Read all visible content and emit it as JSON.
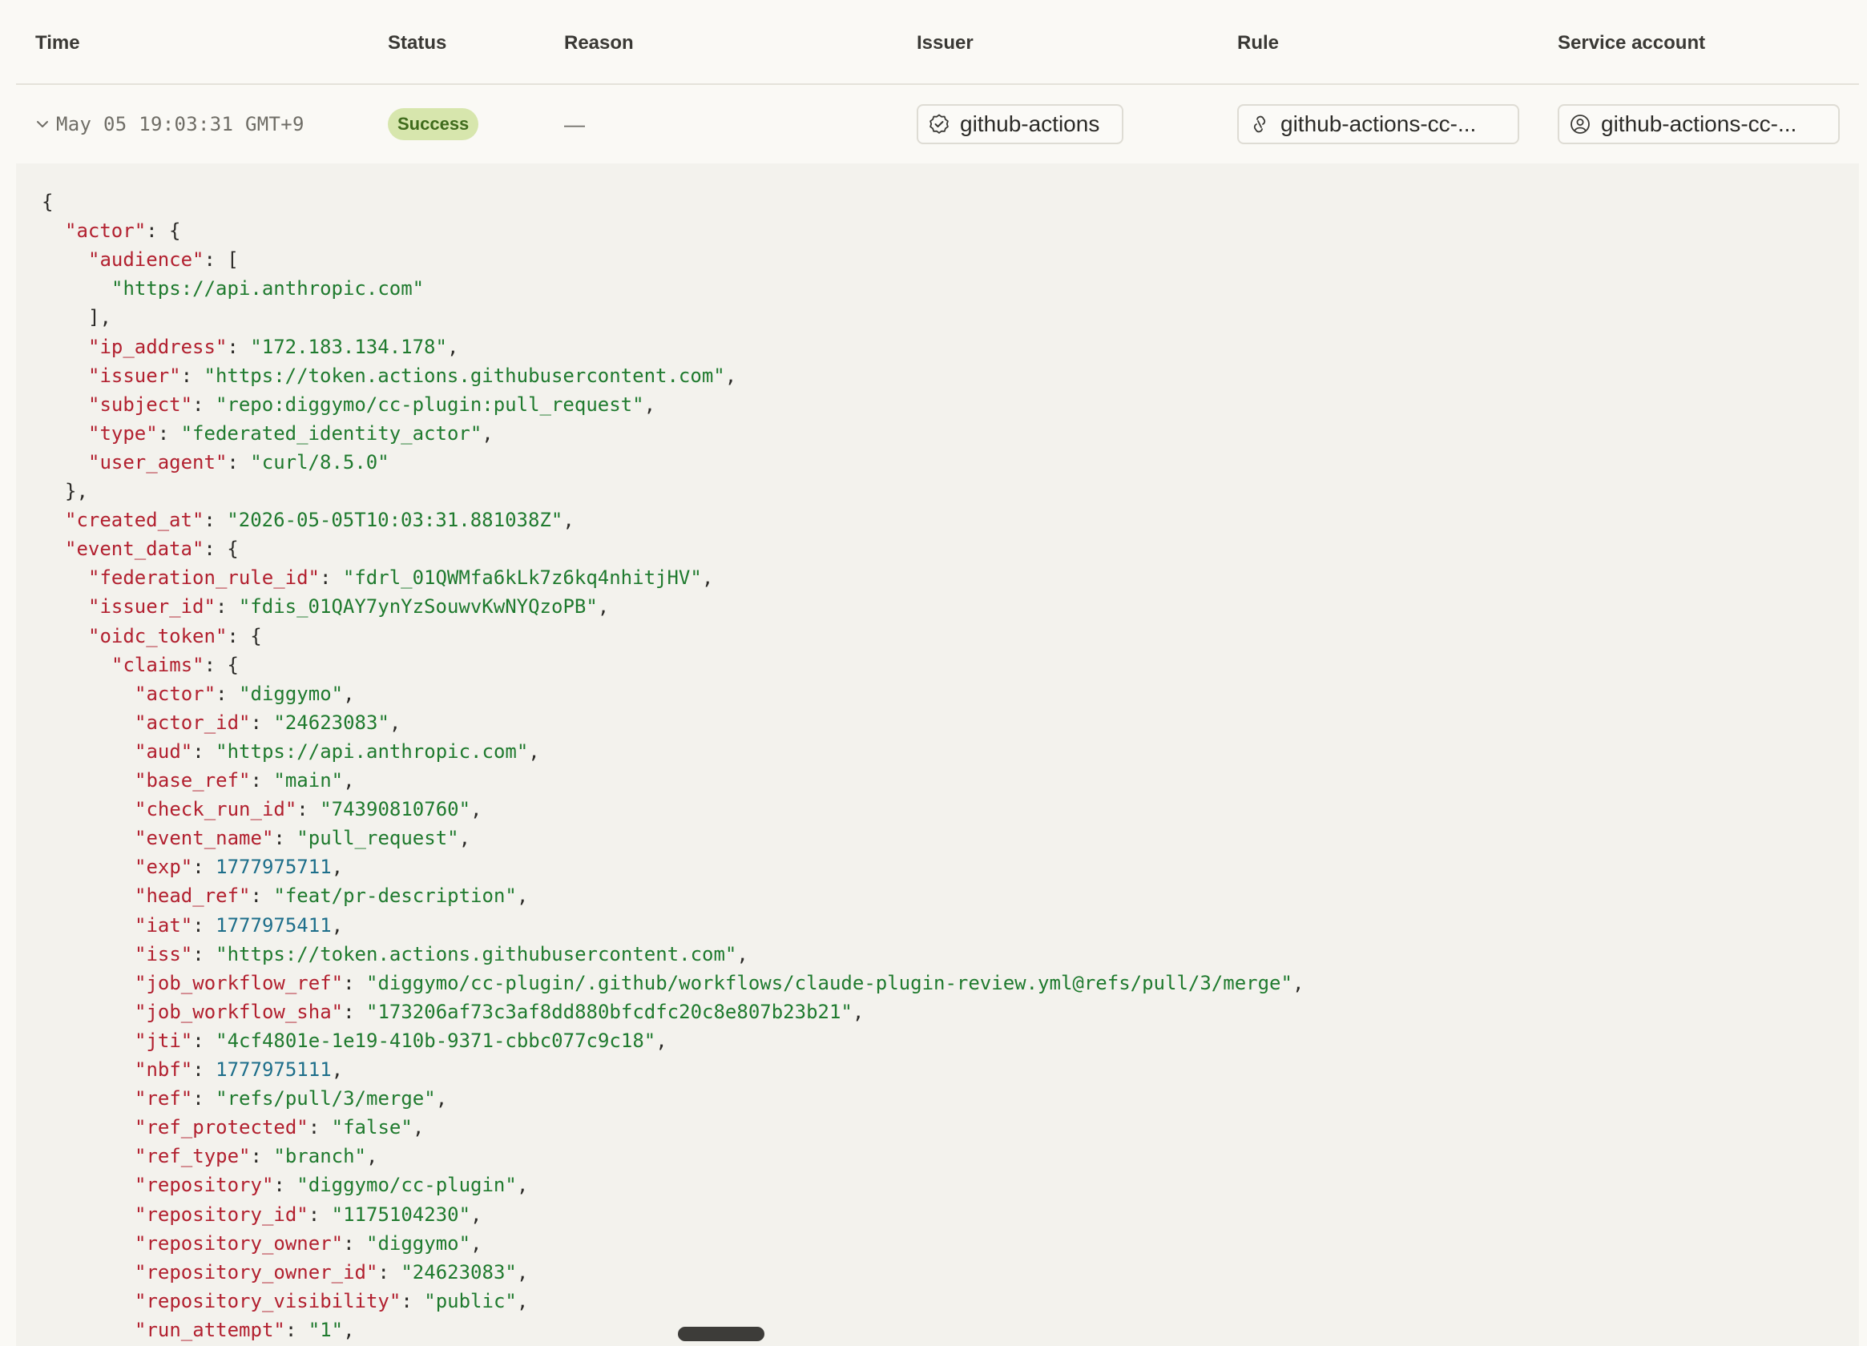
{
  "columns": {
    "time": "Time",
    "status": "Status",
    "reason": "Reason",
    "issuer": "Issuer",
    "rule": "Rule",
    "service_account": "Service account"
  },
  "row": {
    "time": "May 05 19:03:31 GMT+9",
    "status": "Success",
    "reason": "—",
    "issuer": "github-actions",
    "rule": "github-actions-cc-...",
    "service_account": "github-actions-cc-..."
  },
  "colors": {
    "key": "#b2202f",
    "string": "#1f7a2e",
    "number": "#1d6e8a",
    "badge_bg": "#d7e6ad",
    "badge_text": "#3f6b1c"
  },
  "icons": {
    "expand": "chevron-down-icon",
    "issuer": "verified-badge-icon",
    "rule": "link-icon",
    "service_account": "user-circle-icon"
  },
  "json_lines": [
    {
      "indent": 0,
      "parts": [
        {
          "t": "p",
          "v": "{"
        }
      ]
    },
    {
      "indent": 1,
      "parts": [
        {
          "t": "k",
          "v": "\"actor\""
        },
        {
          "t": "p",
          "v": ": {"
        }
      ]
    },
    {
      "indent": 2,
      "parts": [
        {
          "t": "k",
          "v": "\"audience\""
        },
        {
          "t": "p",
          "v": ": ["
        }
      ]
    },
    {
      "indent": 3,
      "parts": [
        {
          "t": "s",
          "v": "\"https://api.anthropic.com\""
        }
      ]
    },
    {
      "indent": 2,
      "parts": [
        {
          "t": "p",
          "v": "],"
        }
      ]
    },
    {
      "indent": 2,
      "parts": [
        {
          "t": "k",
          "v": "\"ip_address\""
        },
        {
          "t": "p",
          "v": ": "
        },
        {
          "t": "s",
          "v": "\"172.183.134.178\""
        },
        {
          "t": "p",
          "v": ","
        }
      ]
    },
    {
      "indent": 2,
      "parts": [
        {
          "t": "k",
          "v": "\"issuer\""
        },
        {
          "t": "p",
          "v": ": "
        },
        {
          "t": "s",
          "v": "\"https://token.actions.githubusercontent.com\""
        },
        {
          "t": "p",
          "v": ","
        }
      ]
    },
    {
      "indent": 2,
      "parts": [
        {
          "t": "k",
          "v": "\"subject\""
        },
        {
          "t": "p",
          "v": ": "
        },
        {
          "t": "s",
          "v": "\"repo:diggymo/cc-plugin:pull_request\""
        },
        {
          "t": "p",
          "v": ","
        }
      ]
    },
    {
      "indent": 2,
      "parts": [
        {
          "t": "k",
          "v": "\"type\""
        },
        {
          "t": "p",
          "v": ": "
        },
        {
          "t": "s",
          "v": "\"federated_identity_actor\""
        },
        {
          "t": "p",
          "v": ","
        }
      ]
    },
    {
      "indent": 2,
      "parts": [
        {
          "t": "k",
          "v": "\"user_agent\""
        },
        {
          "t": "p",
          "v": ": "
        },
        {
          "t": "s",
          "v": "\"curl/8.5.0\""
        }
      ]
    },
    {
      "indent": 1,
      "parts": [
        {
          "t": "p",
          "v": "},"
        }
      ]
    },
    {
      "indent": 1,
      "parts": [
        {
          "t": "k",
          "v": "\"created_at\""
        },
        {
          "t": "p",
          "v": ": "
        },
        {
          "t": "s",
          "v": "\"2026-05-05T10:03:31.881038Z\""
        },
        {
          "t": "p",
          "v": ","
        }
      ]
    },
    {
      "indent": 1,
      "parts": [
        {
          "t": "k",
          "v": "\"event_data\""
        },
        {
          "t": "p",
          "v": ": {"
        }
      ]
    },
    {
      "indent": 2,
      "parts": [
        {
          "t": "k",
          "v": "\"federation_rule_id\""
        },
        {
          "t": "p",
          "v": ": "
        },
        {
          "t": "s",
          "v": "\"fdrl_01QWMfa6kLk7z6kq4nhitjHV\""
        },
        {
          "t": "p",
          "v": ","
        }
      ]
    },
    {
      "indent": 2,
      "parts": [
        {
          "t": "k",
          "v": "\"issuer_id\""
        },
        {
          "t": "p",
          "v": ": "
        },
        {
          "t": "s",
          "v": "\"fdis_01QAY7ynYzSouwvKwNYQzoPB\""
        },
        {
          "t": "p",
          "v": ","
        }
      ]
    },
    {
      "indent": 2,
      "parts": [
        {
          "t": "k",
          "v": "\"oidc_token\""
        },
        {
          "t": "p",
          "v": ": {"
        }
      ]
    },
    {
      "indent": 3,
      "parts": [
        {
          "t": "k",
          "v": "\"claims\""
        },
        {
          "t": "p",
          "v": ": {"
        }
      ]
    },
    {
      "indent": 4,
      "parts": [
        {
          "t": "k",
          "v": "\"actor\""
        },
        {
          "t": "p",
          "v": ": "
        },
        {
          "t": "s",
          "v": "\"diggymo\""
        },
        {
          "t": "p",
          "v": ","
        }
      ]
    },
    {
      "indent": 4,
      "parts": [
        {
          "t": "k",
          "v": "\"actor_id\""
        },
        {
          "t": "p",
          "v": ": "
        },
        {
          "t": "s",
          "v": "\"24623083\""
        },
        {
          "t": "p",
          "v": ","
        }
      ]
    },
    {
      "indent": 4,
      "parts": [
        {
          "t": "k",
          "v": "\"aud\""
        },
        {
          "t": "p",
          "v": ": "
        },
        {
          "t": "s",
          "v": "\"https://api.anthropic.com\""
        },
        {
          "t": "p",
          "v": ","
        }
      ]
    },
    {
      "indent": 4,
      "parts": [
        {
          "t": "k",
          "v": "\"base_ref\""
        },
        {
          "t": "p",
          "v": ": "
        },
        {
          "t": "s",
          "v": "\"main\""
        },
        {
          "t": "p",
          "v": ","
        }
      ]
    },
    {
      "indent": 4,
      "parts": [
        {
          "t": "k",
          "v": "\"check_run_id\""
        },
        {
          "t": "p",
          "v": ": "
        },
        {
          "t": "s",
          "v": "\"74390810760\""
        },
        {
          "t": "p",
          "v": ","
        }
      ]
    },
    {
      "indent": 4,
      "parts": [
        {
          "t": "k",
          "v": "\"event_name\""
        },
        {
          "t": "p",
          "v": ": "
        },
        {
          "t": "s",
          "v": "\"pull_request\""
        },
        {
          "t": "p",
          "v": ","
        }
      ]
    },
    {
      "indent": 4,
      "parts": [
        {
          "t": "k",
          "v": "\"exp\""
        },
        {
          "t": "p",
          "v": ": "
        },
        {
          "t": "n",
          "v": "1777975711"
        },
        {
          "t": "p",
          "v": ","
        }
      ]
    },
    {
      "indent": 4,
      "parts": [
        {
          "t": "k",
          "v": "\"head_ref\""
        },
        {
          "t": "p",
          "v": ": "
        },
        {
          "t": "s",
          "v": "\"feat/pr-description\""
        },
        {
          "t": "p",
          "v": ","
        }
      ]
    },
    {
      "indent": 4,
      "parts": [
        {
          "t": "k",
          "v": "\"iat\""
        },
        {
          "t": "p",
          "v": ": "
        },
        {
          "t": "n",
          "v": "1777975411"
        },
        {
          "t": "p",
          "v": ","
        }
      ]
    },
    {
      "indent": 4,
      "parts": [
        {
          "t": "k",
          "v": "\"iss\""
        },
        {
          "t": "p",
          "v": ": "
        },
        {
          "t": "s",
          "v": "\"https://token.actions.githubusercontent.com\""
        },
        {
          "t": "p",
          "v": ","
        }
      ]
    },
    {
      "indent": 4,
      "parts": [
        {
          "t": "k",
          "v": "\"job_workflow_ref\""
        },
        {
          "t": "p",
          "v": ": "
        },
        {
          "t": "s",
          "v": "\"diggymo/cc-plugin/.github/workflows/claude-plugin-review.yml@refs/pull/3/merge\""
        },
        {
          "t": "p",
          "v": ","
        }
      ]
    },
    {
      "indent": 4,
      "parts": [
        {
          "t": "k",
          "v": "\"job_workflow_sha\""
        },
        {
          "t": "p",
          "v": ": "
        },
        {
          "t": "s",
          "v": "\"173206af73c3af8dd880bfcdfc20c8e807b23b21\""
        },
        {
          "t": "p",
          "v": ","
        }
      ]
    },
    {
      "indent": 4,
      "parts": [
        {
          "t": "k",
          "v": "\"jti\""
        },
        {
          "t": "p",
          "v": ": "
        },
        {
          "t": "s",
          "v": "\"4cf4801e-1e19-410b-9371-cbbc077c9c18\""
        },
        {
          "t": "p",
          "v": ","
        }
      ]
    },
    {
      "indent": 4,
      "parts": [
        {
          "t": "k",
          "v": "\"nbf\""
        },
        {
          "t": "p",
          "v": ": "
        },
        {
          "t": "n",
          "v": "1777975111"
        },
        {
          "t": "p",
          "v": ","
        }
      ]
    },
    {
      "indent": 4,
      "parts": [
        {
          "t": "k",
          "v": "\"ref\""
        },
        {
          "t": "p",
          "v": ": "
        },
        {
          "t": "s",
          "v": "\"refs/pull/3/merge\""
        },
        {
          "t": "p",
          "v": ","
        }
      ]
    },
    {
      "indent": 4,
      "parts": [
        {
          "t": "k",
          "v": "\"ref_protected\""
        },
        {
          "t": "p",
          "v": ": "
        },
        {
          "t": "s",
          "v": "\"false\""
        },
        {
          "t": "p",
          "v": ","
        }
      ]
    },
    {
      "indent": 4,
      "parts": [
        {
          "t": "k",
          "v": "\"ref_type\""
        },
        {
          "t": "p",
          "v": ": "
        },
        {
          "t": "s",
          "v": "\"branch\""
        },
        {
          "t": "p",
          "v": ","
        }
      ]
    },
    {
      "indent": 4,
      "parts": [
        {
          "t": "k",
          "v": "\"repository\""
        },
        {
          "t": "p",
          "v": ": "
        },
        {
          "t": "s",
          "v": "\"diggymo/cc-plugin\""
        },
        {
          "t": "p",
          "v": ","
        }
      ]
    },
    {
      "indent": 4,
      "parts": [
        {
          "t": "k",
          "v": "\"repository_id\""
        },
        {
          "t": "p",
          "v": ": "
        },
        {
          "t": "s",
          "v": "\"1175104230\""
        },
        {
          "t": "p",
          "v": ","
        }
      ]
    },
    {
      "indent": 4,
      "parts": [
        {
          "t": "k",
          "v": "\"repository_owner\""
        },
        {
          "t": "p",
          "v": ": "
        },
        {
          "t": "s",
          "v": "\"diggymo\""
        },
        {
          "t": "p",
          "v": ","
        }
      ]
    },
    {
      "indent": 4,
      "parts": [
        {
          "t": "k",
          "v": "\"repository_owner_id\""
        },
        {
          "t": "p",
          "v": ": "
        },
        {
          "t": "s",
          "v": "\"24623083\""
        },
        {
          "t": "p",
          "v": ","
        }
      ]
    },
    {
      "indent": 4,
      "parts": [
        {
          "t": "k",
          "v": "\"repository_visibility\""
        },
        {
          "t": "p",
          "v": ": "
        },
        {
          "t": "s",
          "v": "\"public\""
        },
        {
          "t": "p",
          "v": ","
        }
      ]
    },
    {
      "indent": 4,
      "parts": [
        {
          "t": "k",
          "v": "\"run_attempt\""
        },
        {
          "t": "p",
          "v": ": "
        },
        {
          "t": "s",
          "v": "\"1\""
        },
        {
          "t": "p",
          "v": ","
        }
      ]
    }
  ]
}
